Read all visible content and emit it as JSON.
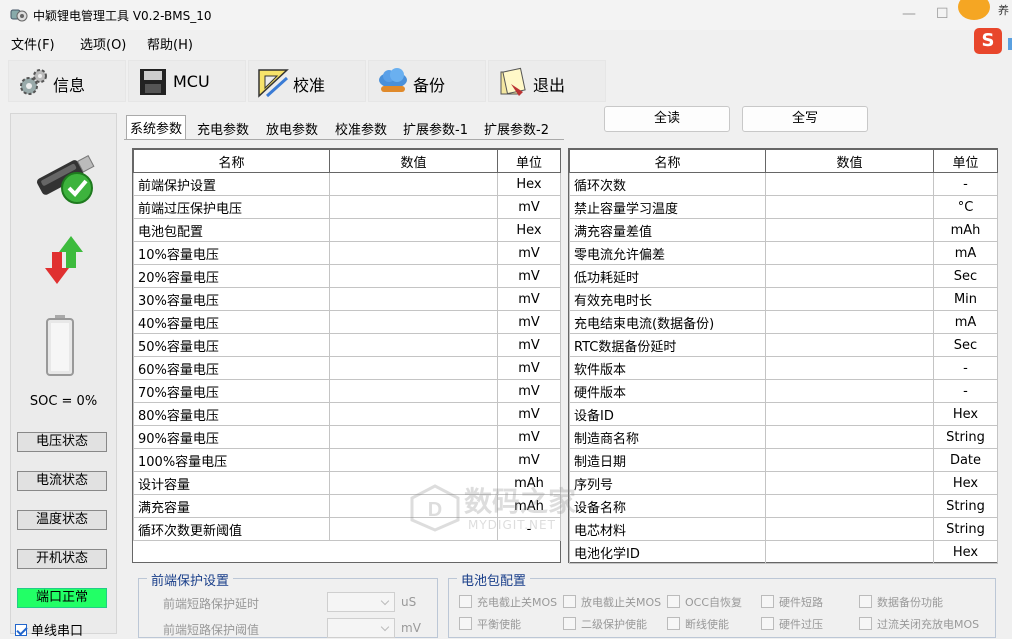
{
  "window": {
    "title": "中颖锂电管理工具 V0.2-BMS_10"
  },
  "ime": {
    "label": "养"
  },
  "menu": [
    {
      "label": "文件(F)"
    },
    {
      "label": "选项(O)"
    },
    {
      "label": "帮助(H)"
    }
  ],
  "toolbar": [
    {
      "label": "信息",
      "icon": "gear-icon"
    },
    {
      "label": "MCU",
      "icon": "chip-icon"
    },
    {
      "label": "校准",
      "icon": "ruler-icon"
    },
    {
      "label": "备份",
      "icon": "cloud-backup-icon"
    },
    {
      "label": "退出",
      "icon": "exit-icon"
    }
  ],
  "status": {
    "soc": "SOC = 0%",
    "buttons": [
      {
        "label": "电压状态"
      },
      {
        "label": "电流状态"
      },
      {
        "label": "温度状态"
      },
      {
        "label": "开机状态"
      },
      {
        "label": "端口正常"
      }
    ],
    "single_port": "单线串口",
    "single_port_checked": true
  },
  "tabs": [
    {
      "label": "系统参数",
      "active": true
    },
    {
      "label": "充电参数"
    },
    {
      "label": "放电参数"
    },
    {
      "label": "校准参数"
    },
    {
      "label": "扩展参数-1"
    },
    {
      "label": "扩展参数-2"
    }
  ],
  "actions": {
    "read_all": "全读",
    "write_all": "全写"
  },
  "columns": {
    "name": "名称",
    "value": "数值",
    "unit": "单位"
  },
  "left_table": [
    {
      "name": "前端保护设置",
      "value": "",
      "unit": "Hex"
    },
    {
      "name": "前端过压保护电压",
      "value": "",
      "unit": "mV"
    },
    {
      "name": "电池包配置",
      "value": "",
      "unit": "Hex"
    },
    {
      "name": "10%容量电压",
      "value": "",
      "unit": "mV"
    },
    {
      "name": "20%容量电压",
      "value": "",
      "unit": "mV"
    },
    {
      "name": "30%容量电压",
      "value": "",
      "unit": "mV"
    },
    {
      "name": "40%容量电压",
      "value": "",
      "unit": "mV"
    },
    {
      "name": "50%容量电压",
      "value": "",
      "unit": "mV"
    },
    {
      "name": "60%容量电压",
      "value": "",
      "unit": "mV"
    },
    {
      "name": "70%容量电压",
      "value": "",
      "unit": "mV"
    },
    {
      "name": "80%容量电压",
      "value": "",
      "unit": "mV"
    },
    {
      "name": "90%容量电压",
      "value": "",
      "unit": "mV"
    },
    {
      "name": "100%容量电压",
      "value": "",
      "unit": "mV"
    },
    {
      "name": "设计容量",
      "value": "",
      "unit": "mAh"
    },
    {
      "name": "满充容量",
      "value": "",
      "unit": "mAh"
    },
    {
      "name": "循环次数更新阈值",
      "value": "",
      "unit": "-"
    }
  ],
  "right_table": [
    {
      "name": "循环次数",
      "value": "",
      "unit": "-"
    },
    {
      "name": "禁止容量学习温度",
      "value": "",
      "unit": "°C"
    },
    {
      "name": "满充容量差值",
      "value": "",
      "unit": "mAh"
    },
    {
      "name": "零电流允许偏差",
      "value": "",
      "unit": "mA"
    },
    {
      "name": "低功耗延时",
      "value": "",
      "unit": "Sec"
    },
    {
      "name": "有效充电时长",
      "value": "",
      "unit": "Min"
    },
    {
      "name": "充电结束电流(数据备份)",
      "value": "",
      "unit": "mA"
    },
    {
      "name": "RTC数据备份延时",
      "value": "",
      "unit": "Sec"
    },
    {
      "name": "软件版本",
      "value": "",
      "unit": "-"
    },
    {
      "name": "硬件版本",
      "value": "",
      "unit": "-"
    },
    {
      "name": "设备ID",
      "value": "",
      "unit": "Hex"
    },
    {
      "name": "制造商名称",
      "value": "",
      "unit": "String"
    },
    {
      "name": "制造日期",
      "value": "",
      "unit": "Date"
    },
    {
      "name": "序列号",
      "value": "",
      "unit": "Hex"
    },
    {
      "name": "设备名称",
      "value": "",
      "unit": "String"
    },
    {
      "name": "电芯材料",
      "value": "",
      "unit": "String"
    },
    {
      "name": "电池化学ID",
      "value": "",
      "unit": "Hex"
    }
  ],
  "frontend_group": {
    "title": "前端保护设置",
    "fields": [
      {
        "label": "前端短路保护延时",
        "unit": "uS"
      },
      {
        "label": "前端短路保护阈值",
        "unit": "mV"
      }
    ]
  },
  "pack_group": {
    "title": "电池包配置",
    "options": [
      "充电截止关MOS",
      "放电截止关MOS",
      "OCC自恢复",
      "硬件短路",
      "数据备份功能",
      "平衡使能",
      "二级保护使能",
      "断线使能",
      "硬件过压",
      "过流关闭充放电MOS"
    ]
  },
  "watermark": {
    "text": "数码之家",
    "sub": "MYDIGIT.NET"
  }
}
